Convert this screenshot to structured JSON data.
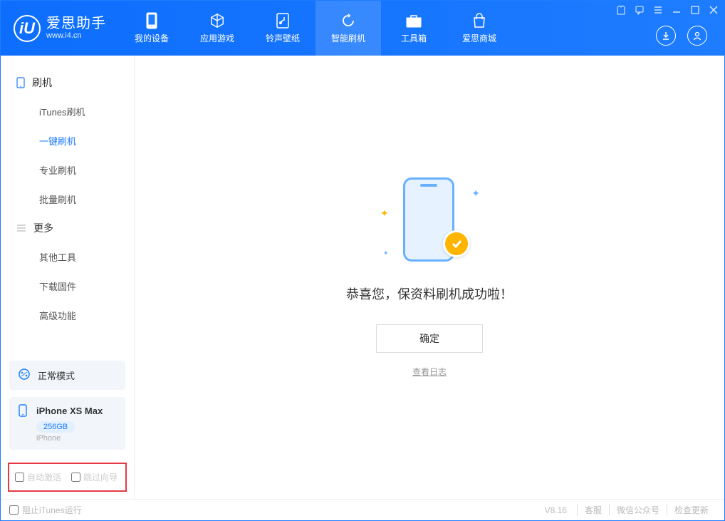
{
  "brand": {
    "cn": "爱思助手",
    "en": "www.i4.cn",
    "logo_letter": "iU"
  },
  "tabs": [
    {
      "label": "我的设备"
    },
    {
      "label": "应用游戏"
    },
    {
      "label": "铃声壁纸"
    },
    {
      "label": "智能刷机"
    },
    {
      "label": "工具箱"
    },
    {
      "label": "爱思商城"
    }
  ],
  "sidebar": {
    "section_flash": "刷机",
    "items_flash": [
      "iTunes刷机",
      "一键刷机",
      "专业刷机",
      "批量刷机"
    ],
    "section_more": "更多",
    "items_more": [
      "其他工具",
      "下载固件",
      "高级功能"
    ]
  },
  "device_mode": {
    "label": "正常模式"
  },
  "device": {
    "name": "iPhone XS Max",
    "capacity": "256GB",
    "type": "iPhone"
  },
  "bottom_checks": {
    "auto_activate": "自动激活",
    "skip_guide": "跳过向导"
  },
  "main": {
    "success": "恭喜您，保资料刷机成功啦！",
    "ok_btn": "确定",
    "view_log": "查看日志"
  },
  "footer": {
    "block_itunes": "阻止iTunes运行",
    "version": "V8.16",
    "links": [
      "客服",
      "微信公众号",
      "检查更新"
    ]
  }
}
